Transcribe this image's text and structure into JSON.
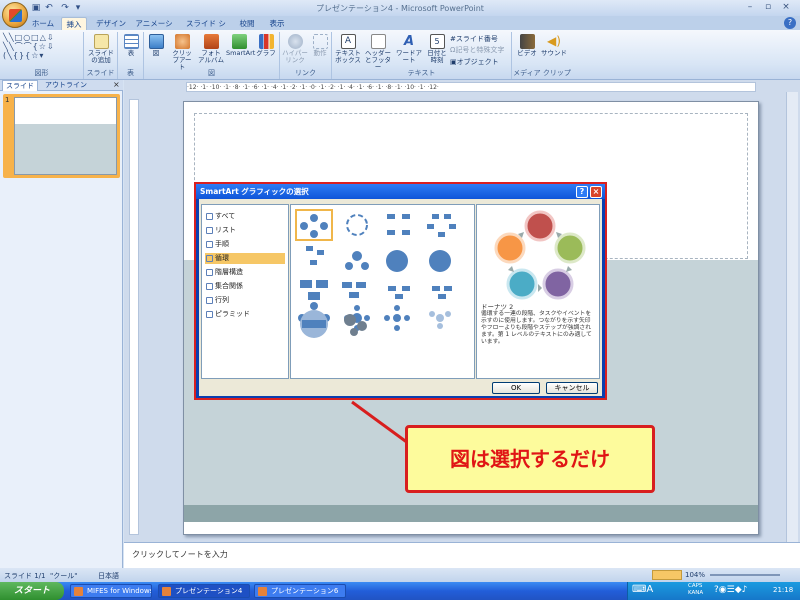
{
  "window": {
    "title": "プレゼンテーション4 - Microsoft PowerPoint"
  },
  "ribbon": {
    "tabs": [
      "ホーム",
      "挿入",
      "デザイン",
      "アニメーション",
      "スライド ショー",
      "校閲",
      "表示"
    ],
    "active_tab": "挿入",
    "groups": {
      "shapes": "図形",
      "slides": "スライド",
      "table": "表",
      "illustrations": "図",
      "links": "リンク",
      "text": "テキスト",
      "media": "メディア クリップ"
    },
    "buttons": {
      "new_slide": "スライドの追加",
      "table": "表",
      "picture": "図",
      "clipart": "クリップアート",
      "photo_album": "フォト アルバム",
      "smartart": "SmartArt",
      "chart": "グラフ",
      "hyperlink": "ハイパーリンク",
      "action": "動作",
      "textbox": "テキストボックス",
      "header_footer": "ヘッダーとフッター",
      "wordart": "ワードアート",
      "datetime": "日付と時刻",
      "slide_number": "スライド番号",
      "symbol": "記号と特殊文字",
      "object": "オブジェクト",
      "movie": "ビデオ",
      "sound": "サウンド"
    }
  },
  "left_panel": {
    "tabs": [
      "スライド",
      "アウトライン"
    ],
    "slide_number": "1"
  },
  "ruler": {
    "marks": "·12· ·1· ·10· ·1· ·8· ·1· ·6· ·1· ·4· ·1· ·2· ·1· ·0· ·1· ·2· ·1· ·4· ·1· ·6· ·1· ·8· ·1· ·10· ·1· ·12·"
  },
  "notes": {
    "placeholder": "クリックしてノートを入力"
  },
  "statusbar": {
    "slide": "スライド 1/1",
    "theme": "\"クール\"",
    "lang": "日本語",
    "zoom": "104%"
  },
  "dialog": {
    "title": "SmartArt グラフィックの選択",
    "categories": [
      "すべて",
      "リスト",
      "手順",
      "循環",
      "階層構造",
      "集合関係",
      "行列",
      "ピラミッド"
    ],
    "selected_category": "循環",
    "preview_title": "ドーナツ 2",
    "preview_desc": "循環する一連の段階、タスクやイベントを示すのに使用します。つながりを示す矢印やフローよりも段階やステップが強調されます。第 1 レベルのテキストにのみ適しています。",
    "ok": "OK",
    "cancel": "キャンセル",
    "help": "?",
    "close": "×"
  },
  "callout": {
    "text": "図は選択するだけ"
  },
  "taskbar": {
    "start": "スタート",
    "tasks": [
      "MIFES for Windows ...",
      "プレゼンテーション4",
      "プレゼンテーション6"
    ],
    "clock": "21:18",
    "tray_text": "CAPS KANA"
  },
  "colors": {
    "accent": "#d81e1e",
    "callout_bg": "#fdfb9c",
    "ribbon": "#d8e5f5",
    "taskbar": "#225ed9"
  }
}
